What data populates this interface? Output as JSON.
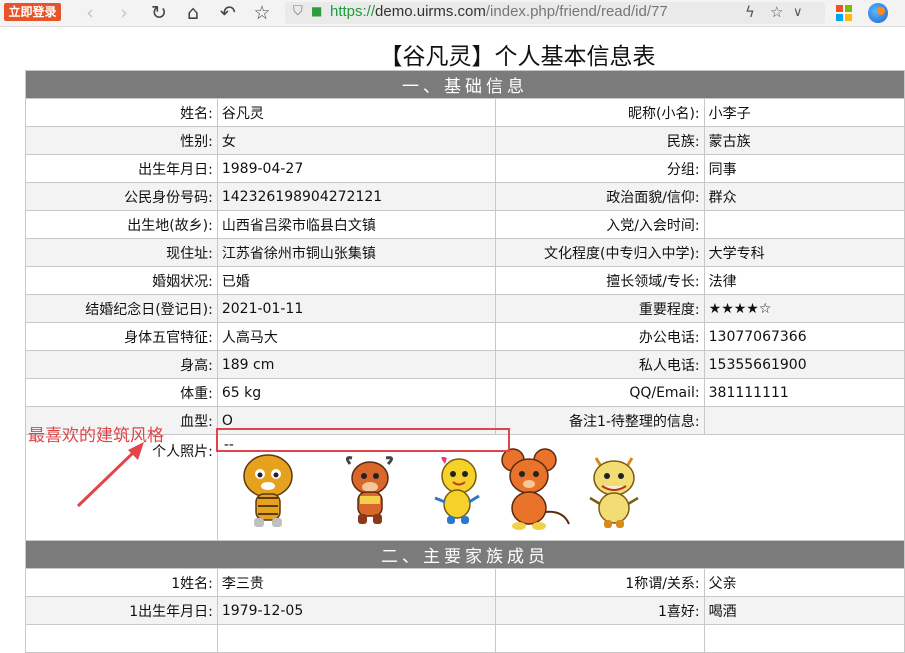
{
  "browser": {
    "login_badge": "立即登录",
    "url_scheme": "https://",
    "url_host": "demo.uirms.com",
    "url_path": "/index.php/friend/read/id/77"
  },
  "page_title": "【谷凡灵】个人基本信息表",
  "sections": {
    "basic": "一、基础信息",
    "family": "二、主要家族成员"
  },
  "basic_rows": [
    {
      "l1": "姓名:",
      "v1": "谷凡灵",
      "l2": "昵称(小名):",
      "v2": "小李子"
    },
    {
      "l1": "性别:",
      "v1": "女",
      "l2": "民族:",
      "v2": "蒙古族"
    },
    {
      "l1": "出生年月日:",
      "v1": "1989-04-27",
      "l2": "分组:",
      "v2": "同事"
    },
    {
      "l1": "公民身份号码:",
      "v1": "142326198904272121",
      "l2": "政治面貌/信仰:",
      "v2": "群众"
    },
    {
      "l1": "出生地(故乡):",
      "v1": "山西省吕梁市临县白文镇",
      "l2": "入党/入会时间:",
      "v2": ""
    },
    {
      "l1": "现住址:",
      "v1": "江苏省徐州市铜山张集镇",
      "l2": "文化程度(中专归入中学):",
      "v2": "大学专科"
    },
    {
      "l1": "婚姻状况:",
      "v1": "已婚",
      "l2": "擅长领域/专长:",
      "v2": "法律"
    },
    {
      "l1": "结婚纪念日(登记日):",
      "v1": "2021-01-11",
      "l2": "重要程度:",
      "v2": "★★★★☆"
    },
    {
      "l1": "身体五官特征:",
      "v1": "人高马大",
      "l2": "办公电话:",
      "v2": "13077067366"
    },
    {
      "l1": "身高:",
      "v1": "189 cm",
      "l2": "私人电话:",
      "v2": "15355661900"
    },
    {
      "l1": "体重:",
      "v1": "65 kg",
      "l2": "QQ/Email:",
      "v2": "381111111"
    },
    {
      "l1": "血型:",
      "v1": "O",
      "l2": "备注1-待整理的信息:",
      "v2": ""
    }
  ],
  "photo_label": "个人照片:",
  "photo_value": "--",
  "family_rows": [
    {
      "l1": "1姓名:",
      "v1": "李三贵",
      "l2": "1称谓/关系:",
      "v2": "父亲"
    },
    {
      "l1": "1出生年月日:",
      "v1": "1979-12-05",
      "l2": "1喜好:",
      "v2": "喝酒"
    }
  ],
  "annotation": "最喜欢的建筑风格",
  "colors": {
    "header_bg": "#7b7b7b",
    "annotation": "#e0454a",
    "url_green": "#1a9c3a",
    "login_badge": "#e8542a"
  }
}
